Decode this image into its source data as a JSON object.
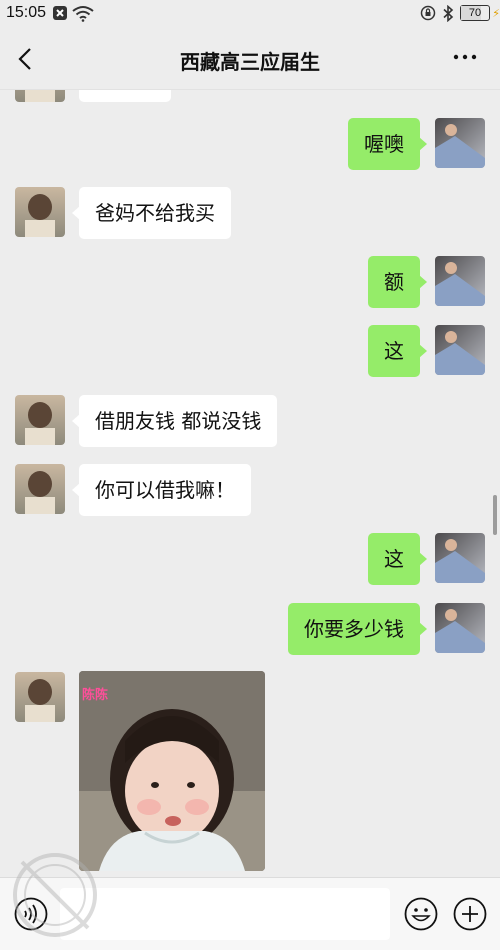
{
  "status": {
    "time": "15:05",
    "battery": "70",
    "battery_level_percent": 70
  },
  "header": {
    "title": "西藏高三应届生"
  },
  "messages": [
    {
      "from": "other",
      "text": ""
    },
    {
      "from": "me",
      "text": "喔噢"
    },
    {
      "from": "other",
      "text": "爸妈不给我买"
    },
    {
      "from": "me",
      "text": "额"
    },
    {
      "from": "me",
      "text": "这"
    },
    {
      "from": "other",
      "text": "借朋友钱 都说没钱"
    },
    {
      "from": "other",
      "text": "你可以借我嘛！"
    },
    {
      "from": "me",
      "text": "这"
    },
    {
      "from": "me",
      "text": "你要多少钱"
    },
    {
      "from": "other",
      "type": "image",
      "caption": "陈陈"
    }
  ],
  "input": {
    "placeholder": ""
  },
  "icons": {
    "back": "chevron-left-icon",
    "more": "more-dots-icon",
    "voice": "voice-icon",
    "emoji": "emoji-icon",
    "plus": "plus-icon"
  },
  "colors": {
    "outgoing_bubble": "#95ec69",
    "incoming_bubble": "#ffffff",
    "background": "#ededed"
  }
}
